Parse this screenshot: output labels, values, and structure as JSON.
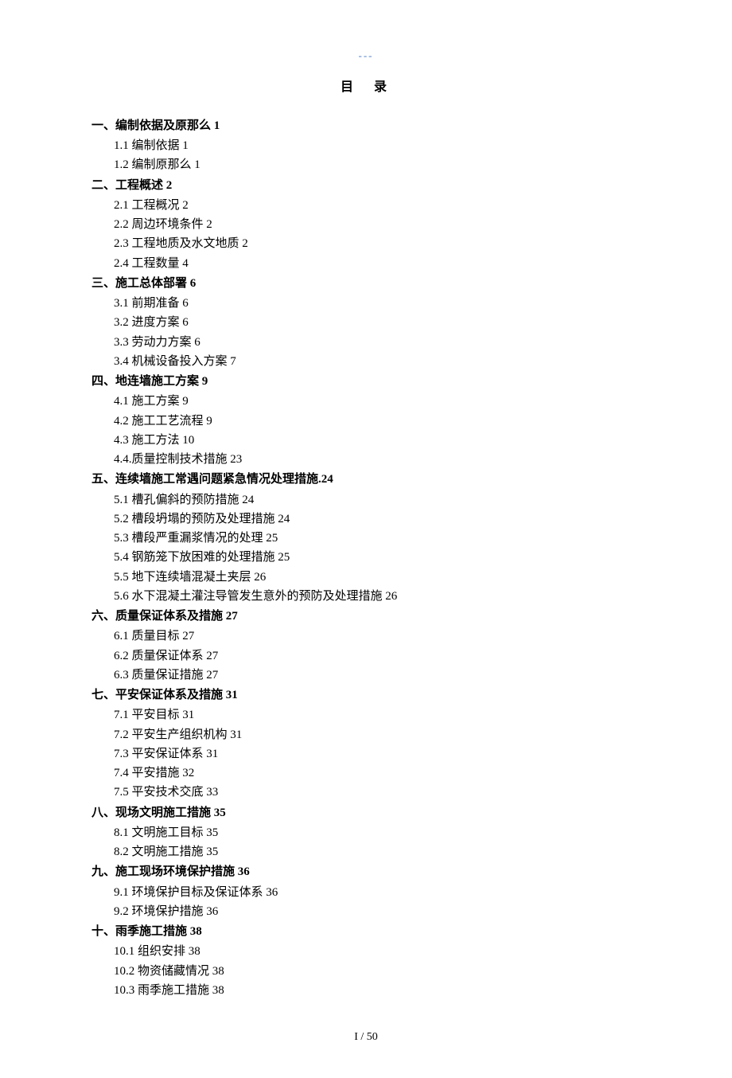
{
  "header_mark": "---",
  "title": "目录",
  "page_footer": "I / 50",
  "sections": [
    {
      "title": "一、编制依据及原那么 1",
      "subs": [
        "1.1 编制依据 1",
        "1.2 编制原那么 1"
      ]
    },
    {
      "title": "二、工程概述 2",
      "subs": [
        "2.1 工程概况 2",
        "2.2 周边环境条件 2",
        "2.3 工程地质及水文地质 2",
        "2.4 工程数量 4"
      ]
    },
    {
      "title": "三、施工总体部署 6",
      "subs": [
        "3.1 前期准备 6",
        "3.2 进度方案 6",
        "3.3 劳动力方案 6",
        "3.4 机械设备投入方案 7"
      ]
    },
    {
      "title": "四、地连墙施工方案 9",
      "subs": [
        "4.1 施工方案 9",
        "4.2 施工工艺流程 9",
        "4.3 施工方法 10",
        "4.4.质量控制技术措施 23"
      ]
    },
    {
      "title": "五、连续墙施工常遇问题紧急情况处理措施.24",
      "subs": [
        "5.1 槽孔偏斜的预防措施 24",
        "5.2 槽段坍塌的预防及处理措施 24",
        "5.3 槽段严重漏浆情况的处理 25",
        "5.4 钢筋笼下放困难的处理措施 25",
        "5.5 地下连续墙混凝土夹层 26",
        "5.6 水下混凝土灌注导管发生意外的预防及处理措施 26"
      ]
    },
    {
      "title": "六、质量保证体系及措施 27",
      "subs": [
        "6.1 质量目标 27",
        "6.2 质量保证体系 27",
        "6.3 质量保证措施 27"
      ]
    },
    {
      "title": "七、平安保证体系及措施 31",
      "subs": [
        "7.1 平安目标 31",
        "7.2 平安生产组织机构 31",
        "7.3 平安保证体系 31",
        "7.4 平安措施 32",
        "7.5 平安技术交底 33"
      ]
    },
    {
      "title": "八、现场文明施工措施 35",
      "subs": [
        "8.1 文明施工目标 35",
        "8.2 文明施工措施 35"
      ]
    },
    {
      "title": "九、施工现场环境保护措施 36",
      "subs": [
        "9.1 环境保护目标及保证体系 36",
        "9.2 环境保护措施 36"
      ]
    },
    {
      "title": "十、雨季施工措施 38",
      "subs": [
        "10.1 组织安排 38",
        "10.2 物资储藏情况 38",
        "10.3 雨季施工措施 38"
      ]
    }
  ]
}
